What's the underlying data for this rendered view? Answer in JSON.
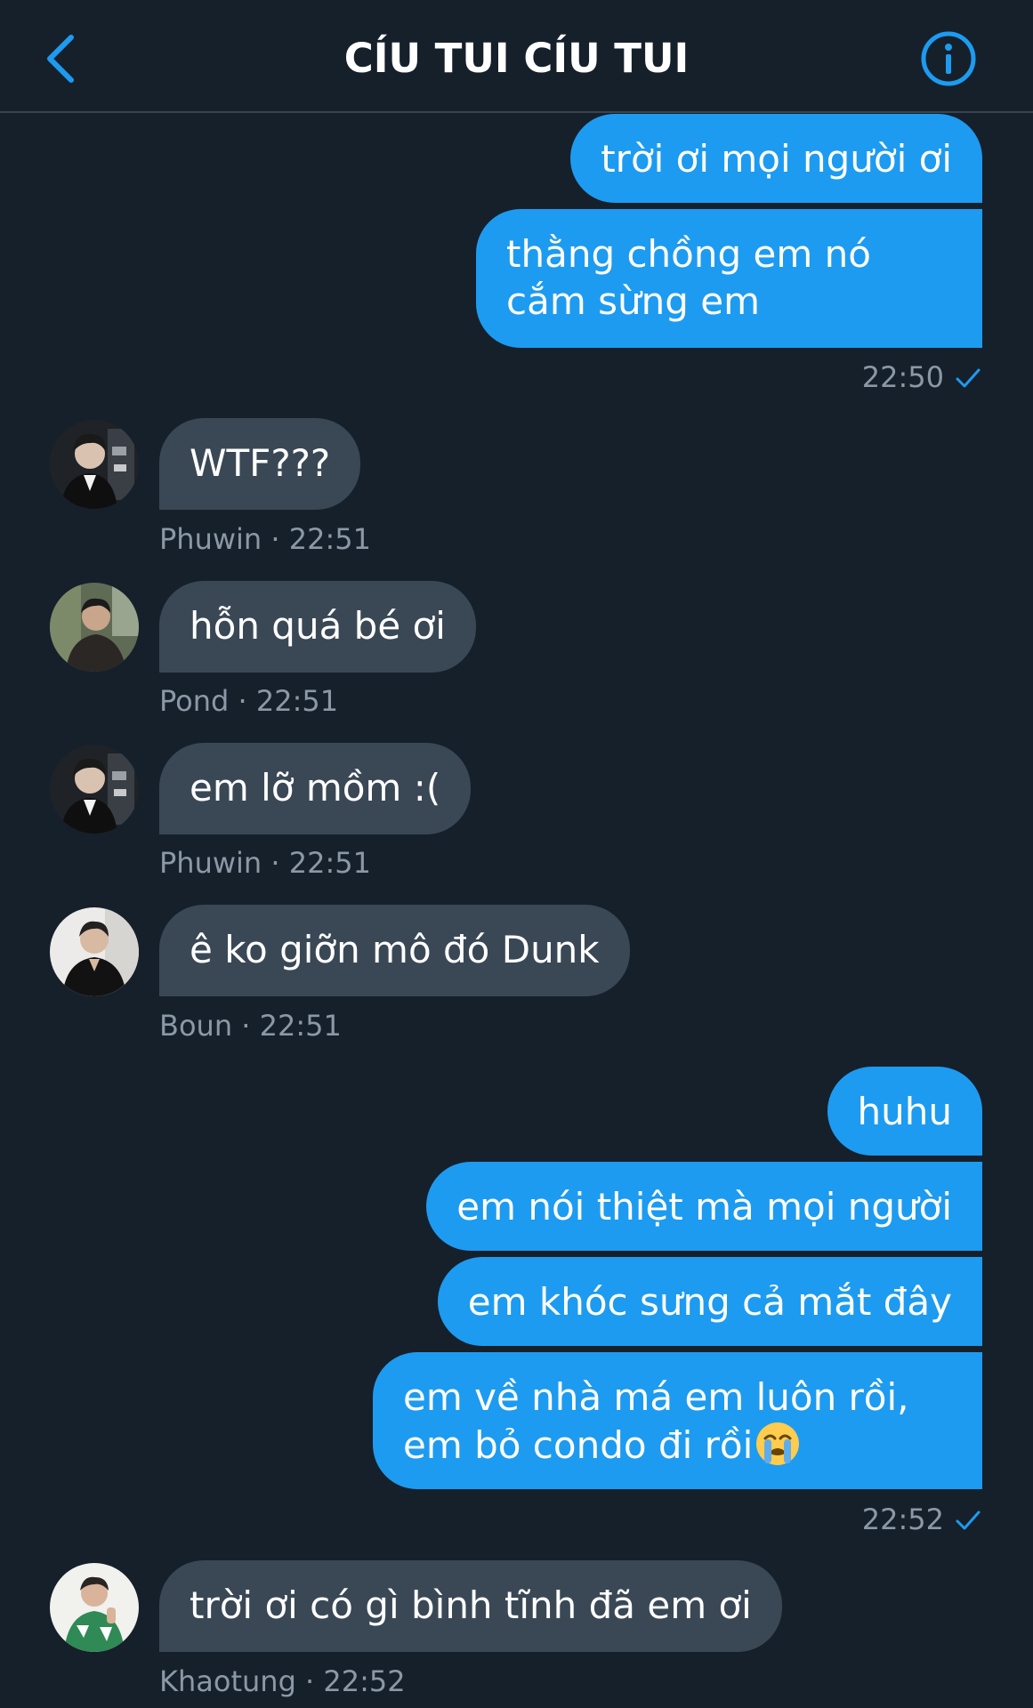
{
  "header": {
    "title": "CÍU TUI CÍU TUI"
  },
  "messages": [
    {
      "dir": "out",
      "text": "trời ơi mọi người ơi"
    },
    {
      "dir": "out",
      "text": "thằng chồng em nó cắm sừng em"
    },
    {
      "meta": "22:50"
    },
    {
      "dir": "in",
      "sender": "Phuwin",
      "text": "WTF???",
      "meta": "Phuwin · 22:51"
    },
    {
      "dir": "in",
      "sender": "Pond",
      "text": "hỗn quá bé ơi",
      "meta": "Pond · 22:51"
    },
    {
      "dir": "in",
      "sender": "Phuwin",
      "text": "em lỡ mồm :(",
      "meta": "Phuwin · 22:51"
    },
    {
      "dir": "in",
      "sender": "Boun",
      "text": "ê ko giỡn mô đó Dunk",
      "meta": "Boun · 22:51"
    },
    {
      "dir": "out",
      "text": "huhu"
    },
    {
      "dir": "out",
      "text": "em nói thiệt mà mọi người"
    },
    {
      "dir": "out",
      "text": "em khóc sưng cả mắt đây"
    },
    {
      "dir": "out",
      "text": "em về nhà má em luôn rồi, em bỏ condo đi rồi"
    },
    {
      "meta": "22:52"
    },
    {
      "dir": "in",
      "sender": "Khaotung",
      "text": "trời ơi có gì bình tĩnh đã em ơi",
      "meta": "Khaotung · 22:52"
    }
  ],
  "colors": {
    "background": "#16202b",
    "outgoing_bubble": "#1d9bf0",
    "incoming_bubble": "#3a4856",
    "meta_text": "#8b98a5",
    "accent": "#1d9bf0"
  },
  "icons": {
    "back": "chevron-left-icon",
    "info": "info-circle-icon",
    "read_receipt": "checkmark-icon",
    "emoji": "loudly-crying-face-emoji"
  }
}
